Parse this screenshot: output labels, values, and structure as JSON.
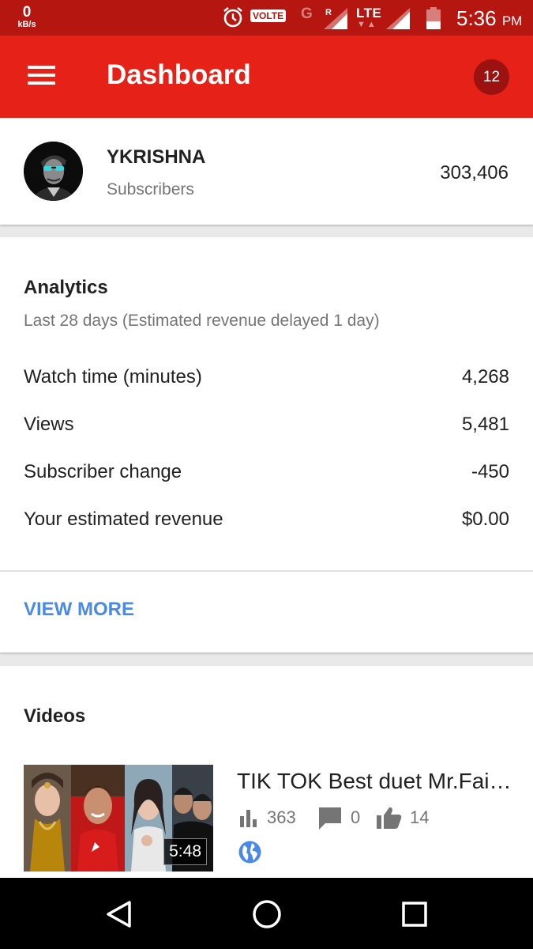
{
  "status_bar": {
    "net_speed_value": "0",
    "net_speed_unit": "kB/s",
    "volte_label": "VOLTE",
    "g_label": "G",
    "r_label": "R",
    "lte_label": "LTE",
    "time": "5:36",
    "ampm": "PM"
  },
  "app_bar": {
    "title": "Dashboard",
    "notification_count": "12"
  },
  "channel": {
    "name": "YKRISHNA",
    "subscribers_label": "Subscribers",
    "subscribers_count": "303,406"
  },
  "analytics": {
    "title": "Analytics",
    "subtitle": "Last 28 days (Estimated revenue delayed 1 day)",
    "metrics": [
      {
        "label": "Watch time (minutes)",
        "value": "4,268"
      },
      {
        "label": "Views",
        "value": "5,481"
      },
      {
        "label": "Subscriber change",
        "value": "-450"
      },
      {
        "label": "Your estimated revenue",
        "value": "$0.00"
      }
    ],
    "view_more_label": "VIEW MORE"
  },
  "videos": {
    "title": "Videos",
    "items": [
      {
        "title": "TIK TOK Best duet Mr.Faisu...",
        "duration": "5:48",
        "views": "363",
        "comments": "0",
        "likes": "14"
      }
    ]
  },
  "colors": {
    "status_bar": "#b51610",
    "app_bar": "#e62117",
    "badge": "#9b1210",
    "link": "#4a8ae6",
    "globe": "#4a8ae6"
  },
  "icons": {
    "menu": "hamburger-menu-icon",
    "alarm": "alarm-clock-icon",
    "signal": "cell-signal-icon",
    "battery": "battery-icon",
    "views": "bar-chart-icon",
    "comments": "comment-bubble-icon",
    "likes": "thumbs-up-icon",
    "visibility": "public-globe-icon",
    "nav_back": "back-triangle-icon",
    "nav_home": "home-circle-icon",
    "nav_recents": "recents-square-icon"
  }
}
